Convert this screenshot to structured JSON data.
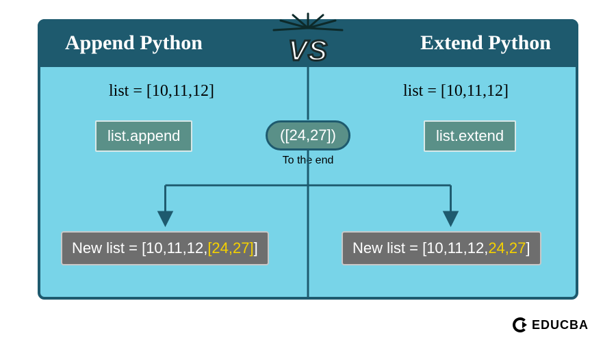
{
  "header": {
    "left_title": "Append Python",
    "right_title": "Extend Python",
    "vs": "VS"
  },
  "left": {
    "list_decl": "list = [10,11,12]",
    "method": "list.append",
    "result_prefix": "New list = [10,11,12,",
    "result_highlight": "[24,27]",
    "result_suffix": "]"
  },
  "right": {
    "list_decl": "list = [10,11,12]",
    "method": "list.extend",
    "result_prefix": "New list = [10,11,12,",
    "result_highlight": "24,27",
    "result_suffix": "]"
  },
  "center": {
    "argument": "([24,27])",
    "to_end": "To the end"
  },
  "branding": {
    "name": "EDUCBA"
  },
  "colors": {
    "frame": "#1e5a6e",
    "panel": "#78d4e8",
    "box": "#5a9088",
    "result": "#6e6e6e",
    "highlight": "#f5d100"
  }
}
